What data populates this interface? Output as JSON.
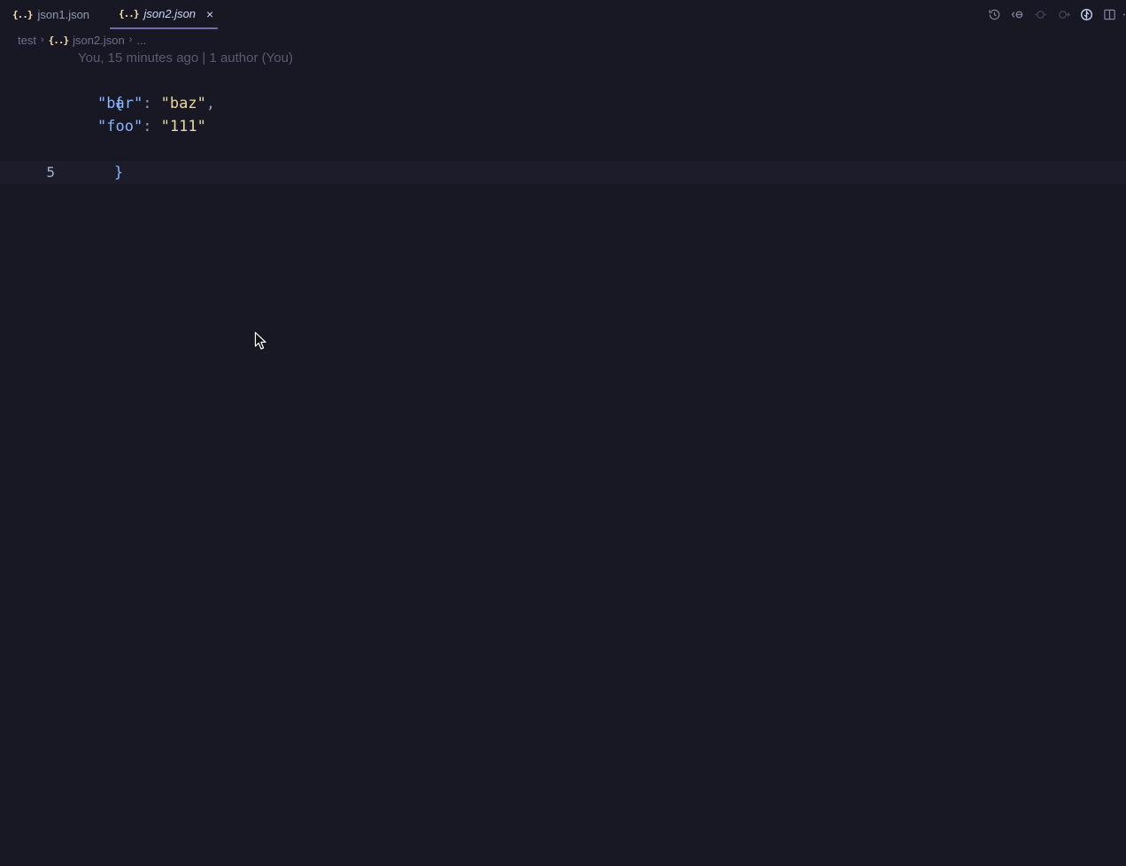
{
  "tabs": [
    {
      "icon": "json-icon",
      "label": "json1.json",
      "active": false
    },
    {
      "icon": "json-icon",
      "label": "json2.json",
      "active": true,
      "close_glyph": "×"
    }
  ],
  "json_icon_glyph": "{..}",
  "editor_actions": [
    {
      "icon": "history-icon"
    },
    {
      "icon": "go-back-icon"
    },
    {
      "icon": "previous-change-icon"
    },
    {
      "icon": "next-change-icon"
    },
    {
      "icon": "git-compare-icon"
    },
    {
      "icon": "split-editor-icon"
    },
    {
      "icon": "more-actions-icon"
    }
  ],
  "breadcrumb": {
    "folder": "test",
    "file": "json2.json",
    "symbol": "..."
  },
  "blame": "You, 15 minutes ago | 1 author (You)",
  "code": {
    "open_brace": "{",
    "lines": [
      {
        "key": "\"bar\"",
        "colon": ": ",
        "value": "\"baz\"",
        "trailing": ","
      },
      {
        "key": "\"foo\"",
        "colon": ": ",
        "value": "\"111\"",
        "trailing": ""
      }
    ],
    "close_brace": "}"
  },
  "current_line_number": "5",
  "colors": {
    "background": "#181825",
    "accent_tab_underline": "#6e6aa8",
    "json_icon": "#f9e2af",
    "key": "#89b4fa",
    "string": "#e8d9a0"
  }
}
